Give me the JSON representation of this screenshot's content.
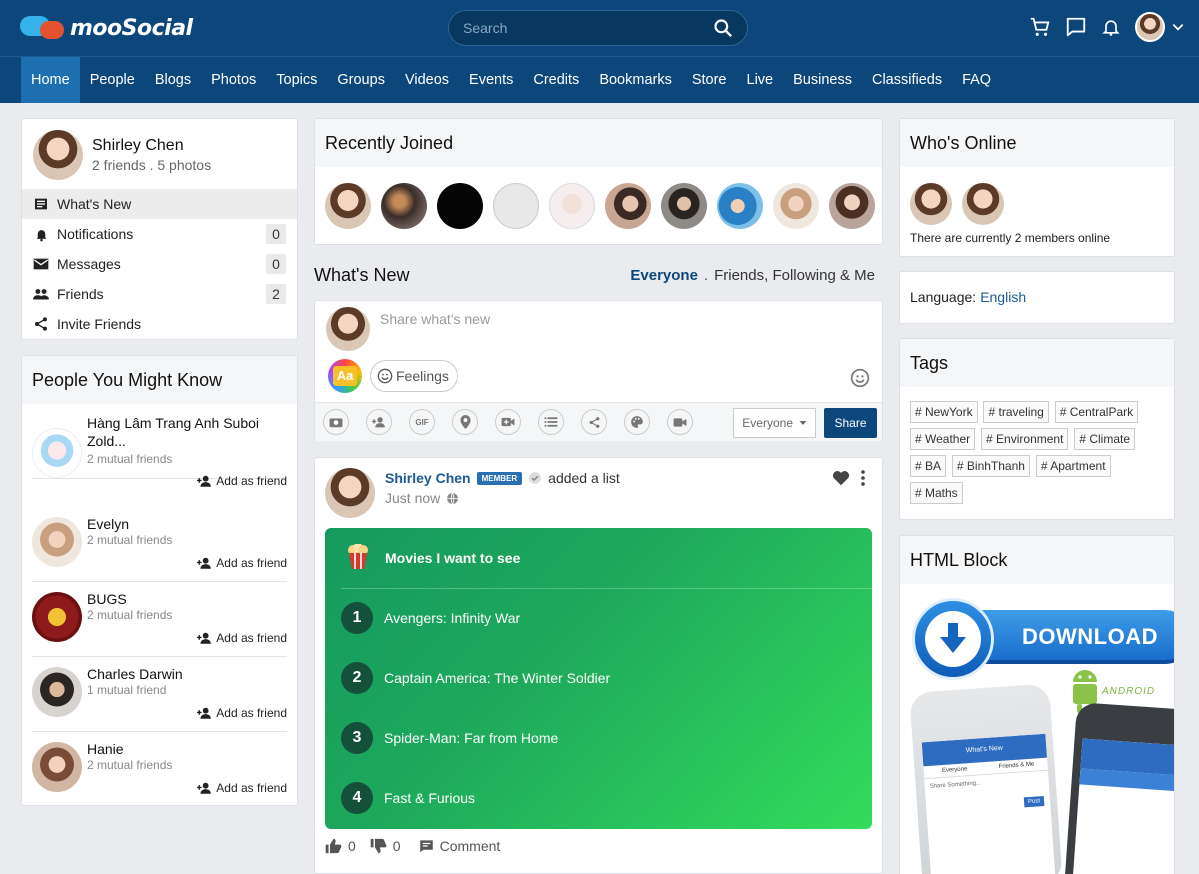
{
  "brand": {
    "name": "mooSocial"
  },
  "search": {
    "placeholder": "Search"
  },
  "nav": [
    "Home",
    "People",
    "Blogs",
    "Photos",
    "Topics",
    "Groups",
    "Videos",
    "Events",
    "Credits",
    "Bookmarks",
    "Store",
    "Live",
    "Business",
    "Classifieds",
    "FAQ"
  ],
  "profile": {
    "name": "Shirley Chen",
    "stats": "2 friends . 5 photos"
  },
  "menu": [
    {
      "label": "What's New",
      "icon": "news-icon",
      "count": ""
    },
    {
      "label": "Notifications",
      "icon": "bell-icon",
      "count": "0"
    },
    {
      "label": "Messages",
      "icon": "envelope-icon",
      "count": "0"
    },
    {
      "label": "Friends",
      "icon": "friends-icon",
      "count": "2"
    },
    {
      "label": "Invite Friends",
      "icon": "share-icon",
      "count": ""
    }
  ],
  "pymk": {
    "title": "People You Might Know",
    "add_label": "Add as friend",
    "people": [
      {
        "name": "Hàng Lâm Trang Anh Suboi Zold...",
        "mutual": "2 mutual friends"
      },
      {
        "name": "Evelyn",
        "mutual": "2 mutual friends"
      },
      {
        "name": "BUGS",
        "mutual": "2 mutual friends"
      },
      {
        "name": "Charles Darwin",
        "mutual": "1 mutual friend"
      },
      {
        "name": "Hanie",
        "mutual": "2 mutual friends"
      }
    ]
  },
  "recent": {
    "title": "Recently Joined"
  },
  "whatsnew": {
    "title": "What's New",
    "filter_active": "Everyone",
    "filter_sep": ".",
    "filter_other": "Friends, Following & Me",
    "placeholder": "Share what's new",
    "aa": "Aa",
    "feelings": "Feelings",
    "privacy": "Everyone",
    "share": "Share"
  },
  "post": {
    "author": "Shirley Chen",
    "badge": "MEMBER",
    "action": "added a list",
    "time": "Just now",
    "list_title": "Movies I want to see",
    "items": [
      {
        "num": "1",
        "text": "Avengers: Infinity War"
      },
      {
        "num": "2",
        "text": "Captain America: The Winter Soldier"
      },
      {
        "num": "3",
        "text": "Spider-Man: Far from Home"
      },
      {
        "num": "4",
        "text": "Fast & Furious"
      }
    ],
    "likes": "0",
    "dislikes": "0",
    "comment": "Comment"
  },
  "online": {
    "title": "Who's Online",
    "text": "There are currently 2 members online"
  },
  "language": {
    "label": "Language:",
    "value": "English"
  },
  "tags": {
    "title": "Tags",
    "items": [
      "# NewYork",
      "# traveling",
      "# CentralPark",
      "# Weather",
      "# Environment",
      "# Climate",
      "# BA",
      "# BinhThanh",
      "# Apartment",
      "# Maths"
    ]
  },
  "html_block": {
    "title": "HTML Block",
    "download": "DOWNLOAD",
    "android": "ANDROID",
    "phone_header": "What's New",
    "phone_tab1": "Everyone",
    "phone_tab2": "Friends & Me",
    "phone_share": "Share Something...",
    "phone_post": "Post"
  },
  "colors": {
    "header": "#0c467a",
    "accent": "#1d6fb0",
    "list_green": "#1ea85c"
  }
}
